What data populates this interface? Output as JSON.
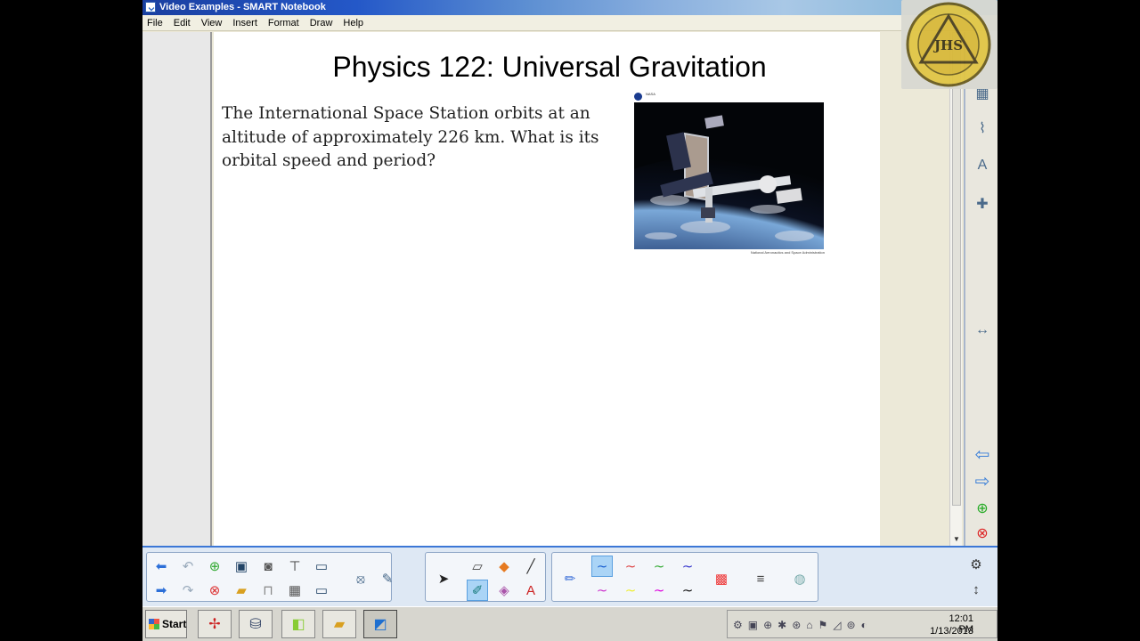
{
  "window": {
    "title": "Video Examples - SMART Notebook",
    "controls": [
      "_",
      "□",
      "×"
    ]
  },
  "menu": [
    "File",
    "Edit",
    "View",
    "Insert",
    "Format",
    "Draw",
    "Help"
  ],
  "page": {
    "title": "Physics 122: Universal Gravitation",
    "problem": "The International Space Station orbits at an altitude of approximately 226 km. What is its orbital speed and period?",
    "image_caption_top": "NASA",
    "image_caption_bottom": "National Aeronautics and Space Administration"
  },
  "watermark": {
    "text": "JHS"
  },
  "sidetabs": [
    "page-sorter",
    "gallery",
    "attachments",
    "properties",
    "addons",
    "resize",
    "previous-page",
    "next-page",
    "add-page",
    "delete-page"
  ],
  "taskbar": {
    "start_label": "Start",
    "time": "12:01 PM",
    "date": "1/13/2013"
  },
  "colors": {
    "accent": "#3c77d6",
    "toolbar_bg": "#dee8f4",
    "pen_colors": [
      "#1a5fd0",
      "#d44",
      "#3a3",
      "#33c",
      "#c3c",
      "#ee3",
      "#d0d",
      "#111"
    ]
  }
}
